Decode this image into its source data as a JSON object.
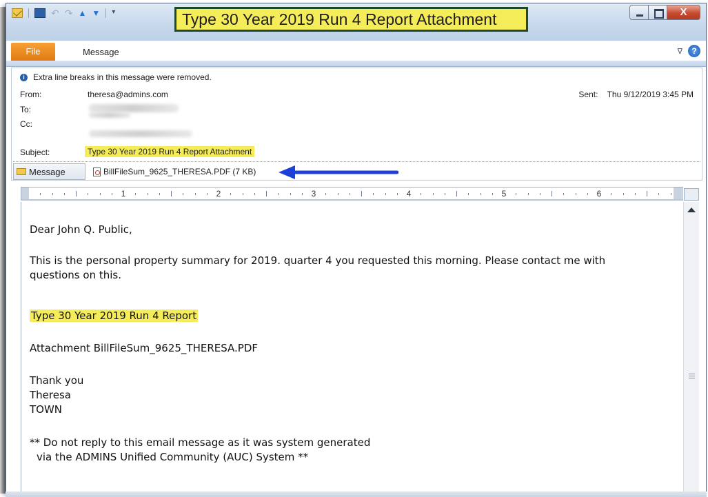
{
  "window": {
    "title": "Type 30 Year 2019 Run 4 Report Attachment",
    "close_glyph": "X",
    "title_highlight_color": "#f5ec5a",
    "title_border_color": "#1f4a2a"
  },
  "ribbon": {
    "file_tab": "File",
    "message_tab": "Message",
    "help_glyph": "?",
    "minimize_glyph": "∇"
  },
  "header": {
    "info_text": "Extra line breaks in this message were removed.",
    "from_label": "From:",
    "from_value": "theresa@admins.com",
    "to_label": "To:",
    "cc_label": "Cc:",
    "subject_label": "Subject:",
    "subject_value": "Type 30 Year 2019 Run 4 Report Attachment",
    "sent_label": "Sent:",
    "sent_value": "Thu 9/12/2019 3:45 PM"
  },
  "tabs": {
    "message_tab_label": "Message",
    "attachment_label": "BillFileSum_9625_THERESA.PDF (7 KB)"
  },
  "ruler": {
    "numbers": [
      "1",
      "2",
      "3",
      "4",
      "5",
      "6"
    ]
  },
  "body": {
    "greeting": "Dear John Q. Public,",
    "para1_line1": "This is the personal property summary for 2019. quarter 4 you requested this morning. Please contact me with",
    "para1_line2": "questions on this.",
    "report_title": "Type 30 Year 2019 Run 4 Report",
    "attachment_line": "Attachment BillFileSum_9625_THERESA.PDF",
    "thanks": "Thank you",
    "name": "Theresa",
    "org": "TOWN",
    "footer_line1": "** Do not reply to this email message as it was system generated",
    "footer_line2": "via the ADMINS Unified Community (AUC) System **"
  },
  "colors": {
    "highlight": "#f5ec5a",
    "arrow": "#1f3fd9",
    "file_tab": "#f08c1e",
    "close_button": "#c74b33"
  }
}
